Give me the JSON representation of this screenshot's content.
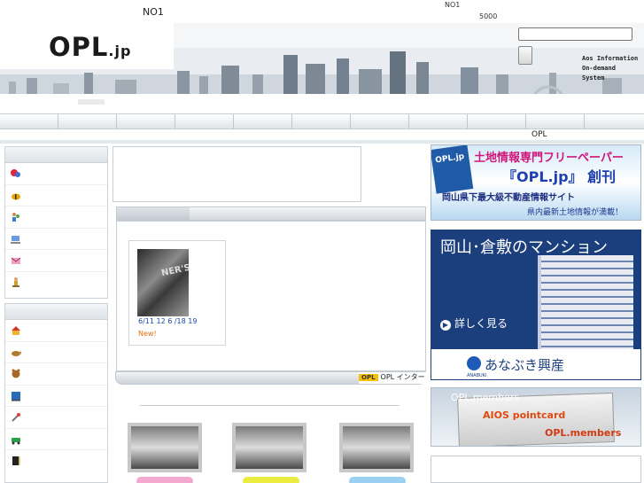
{
  "top_strip": {
    "no1_left": "NO1",
    "no1_mid": "NO1",
    "count": "5000"
  },
  "header": {
    "logo_main": "OPL",
    "logo_dot": ".jp",
    "search_placeholder": "",
    "aios_lines": [
      "Aos Information",
      "On-demand",
      "System"
    ]
  },
  "nav": {
    "items": [
      "",
      "",
      "",
      "",
      "",
      "",
      "",
      "",
      "",
      "",
      ""
    ]
  },
  "sub_nav": {
    "label": "OPL"
  },
  "left_panel_1": {
    "icons": [
      "balloon-icon",
      "bee-icon",
      "people-icon",
      "pc-icon",
      "mail-icon",
      "walker-icon"
    ]
  },
  "left_panel_2": {
    "icons": [
      "house-icon",
      "turtle-icon",
      "bear-icon",
      "blue-box-icon",
      "tools-icon",
      "car-icon",
      "book-icon"
    ]
  },
  "news": {
    "date": "6/11 12 6 /18 19",
    "new_label": "New!",
    "thumb_text": "NER'S"
  },
  "footer_badge": {
    "logo": "OPL",
    "text": "OPL インター"
  },
  "ads": {
    "ad1": {
      "title": "土地情報専門フリーペーパー",
      "title2": "『OPL.jp』 創刊",
      "book": "OPL.jp",
      "sub": "岡山県下最大級不動産情報サイト",
      "foot": "県内最新土地情報が満載！"
    },
    "ad2": {
      "title": "岡山･倉敷のマンション",
      "button": "詳しく見る",
      "company": "あなぶき興産",
      "brand": "ANABUKI"
    },
    "ad3": {
      "head": "OPL.members",
      "aios": "AIOS pointcard",
      "members": "OPL.members"
    }
  },
  "colors": {
    "accent_blue": "#1b3e7c",
    "new_orange": "#e07010",
    "link_blue": "#1a4aa8"
  }
}
